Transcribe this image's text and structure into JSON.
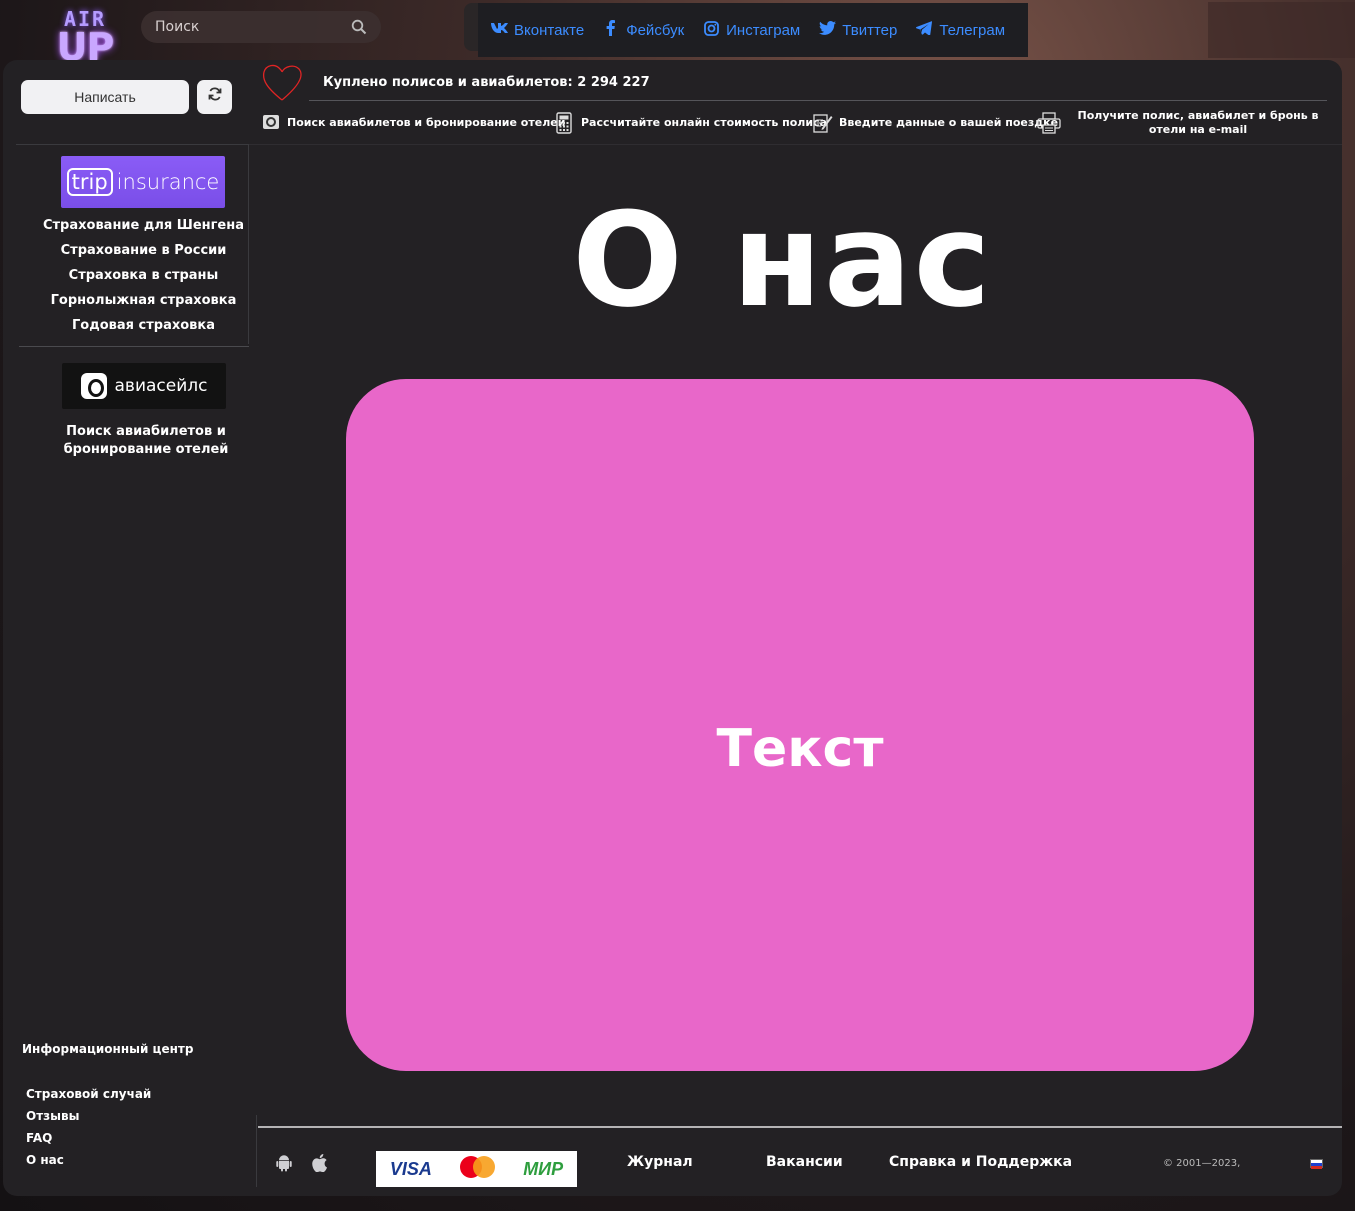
{
  "header": {
    "logo_top": "AIR",
    "logo_bottom": "UP",
    "search_placeholder": "Поиск",
    "social": [
      {
        "icon": "vk-icon",
        "glyph": "vk",
        "label": "Вконтакте"
      },
      {
        "icon": "facebook-icon",
        "glyph": "f",
        "label": "Фейсбук"
      },
      {
        "icon": "instagram-icon",
        "glyph": "◎",
        "label": "Инстаграм"
      },
      {
        "icon": "twitter-icon",
        "glyph": "🐦",
        "label": "Твиттер"
      },
      {
        "icon": "telegram-icon",
        "glyph": "➤",
        "label": "Телеграм"
      }
    ]
  },
  "sidebar": {
    "write_button": "Написать",
    "refresh_icon": "refresh-icon",
    "trip_logo": {
      "part1": "trip",
      "part2": "insurance"
    },
    "links": [
      "Страхование для Шенгена",
      "Страхование в России",
      "Страховка в страны",
      "Горнолыжная страховка",
      "Годовая страховка"
    ],
    "avia_logo": "авиасейлс",
    "avia_text": "Поиск авиабилетов и бронирование отелей",
    "info_title": "Информационный центр",
    "info_links": [
      "Страховой случай",
      "Отзывы",
      "FAQ",
      "О нас"
    ]
  },
  "topinfo": {
    "counter": "Куплено полисов и авиабилетов: 2 294 227",
    "steps": [
      {
        "icon": "ticket-icon",
        "text": "Поиск авиабилетов и бронирование отелей"
      },
      {
        "icon": "calculator-icon",
        "text": "Рассчитайте онлайн стоимость полиса"
      },
      {
        "icon": "edit-form-icon",
        "text": "Введите данные о вашей поездке"
      },
      {
        "icon": "printer-icon",
        "text": "Получите полис, авиабилет и бронь в отели на e-mail"
      }
    ]
  },
  "main": {
    "title": "О нас",
    "card_text": "Текст",
    "card_color": "#e867c9"
  },
  "footer": {
    "payments": {
      "visa": "VISA",
      "mir": "МИР"
    },
    "links": [
      "Журнал",
      "Вакансии",
      "Справка и Поддержка"
    ],
    "copyright": "© 2001—2023, "
  }
}
